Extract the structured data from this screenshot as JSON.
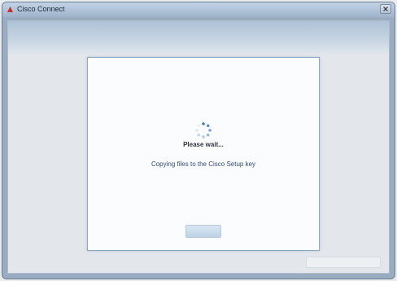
{
  "window": {
    "title": "Cisco Connect",
    "icon": "app-logo-icon",
    "close_icon": "close-icon"
  },
  "banner": {
    "text": ""
  },
  "dialog": {
    "spinner_icon": "loading-spinner-icon",
    "wait_label": "Please wait...",
    "status_label": "Copying files to the Cisco Setup key",
    "button_label": ""
  },
  "colors": {
    "accent": "#3f7fc4",
    "title_bar": "#b3c6db",
    "frame": "#9aacc1",
    "status_text": "#304a7a"
  }
}
